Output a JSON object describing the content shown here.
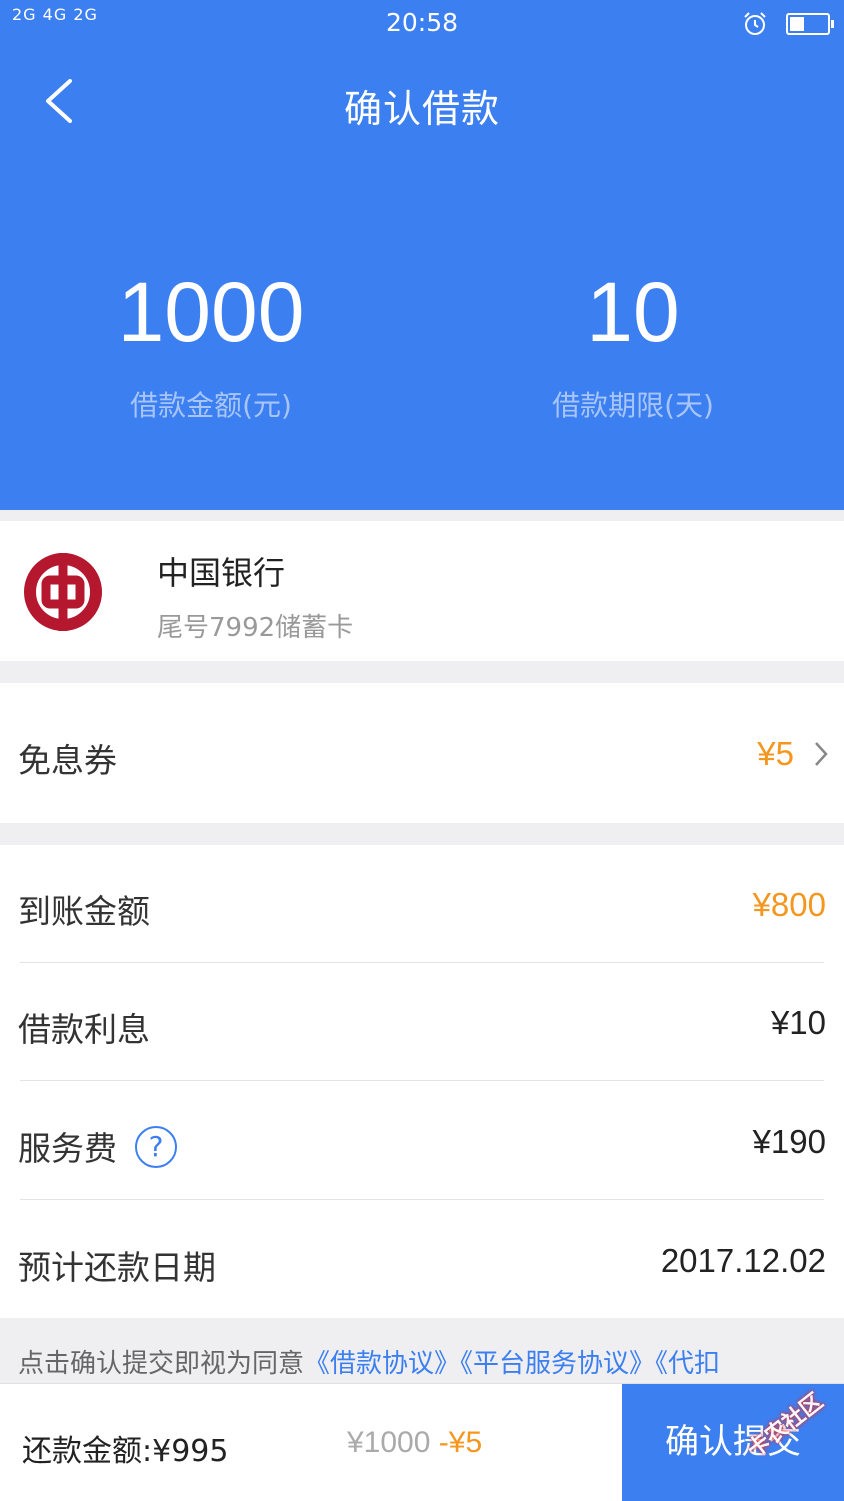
{
  "status_bar": {
    "signal": "2G 4G 2G",
    "time": "20:58"
  },
  "header": {
    "title": "确认借款",
    "amount_value": "1000",
    "amount_label": "借款金额(元)",
    "term_value": "10",
    "term_label": "借款期限(天)"
  },
  "bank": {
    "name": "中国银行",
    "card": "尾号7992储蓄卡",
    "brand_color": "#b5172e"
  },
  "coupon": {
    "label": "免息券",
    "value": "¥5"
  },
  "details": [
    {
      "label": "到账金额",
      "value": "¥800"
    },
    {
      "label": "借款利息",
      "value": "¥10"
    },
    {
      "label": "服务费",
      "value": "¥190"
    },
    {
      "label": "预计还款日期",
      "value": "2017.12.02"
    }
  ],
  "agreement": {
    "prefix": "点击确认提交即视为同意",
    "link1": "《借款协议》",
    "link2": "《平台服务协议》",
    "link3": "《代扣"
  },
  "footer": {
    "repay_label": "还款金额:",
    "repay_value": "¥995",
    "calc_base": "¥1000",
    "calc_minus": "-",
    "calc_discount": "¥5",
    "submit_label": "确认提交"
  },
  "watermark": "卡农社区",
  "colors": {
    "accent": "#3c7ff0",
    "highlight": "#f5961e"
  }
}
